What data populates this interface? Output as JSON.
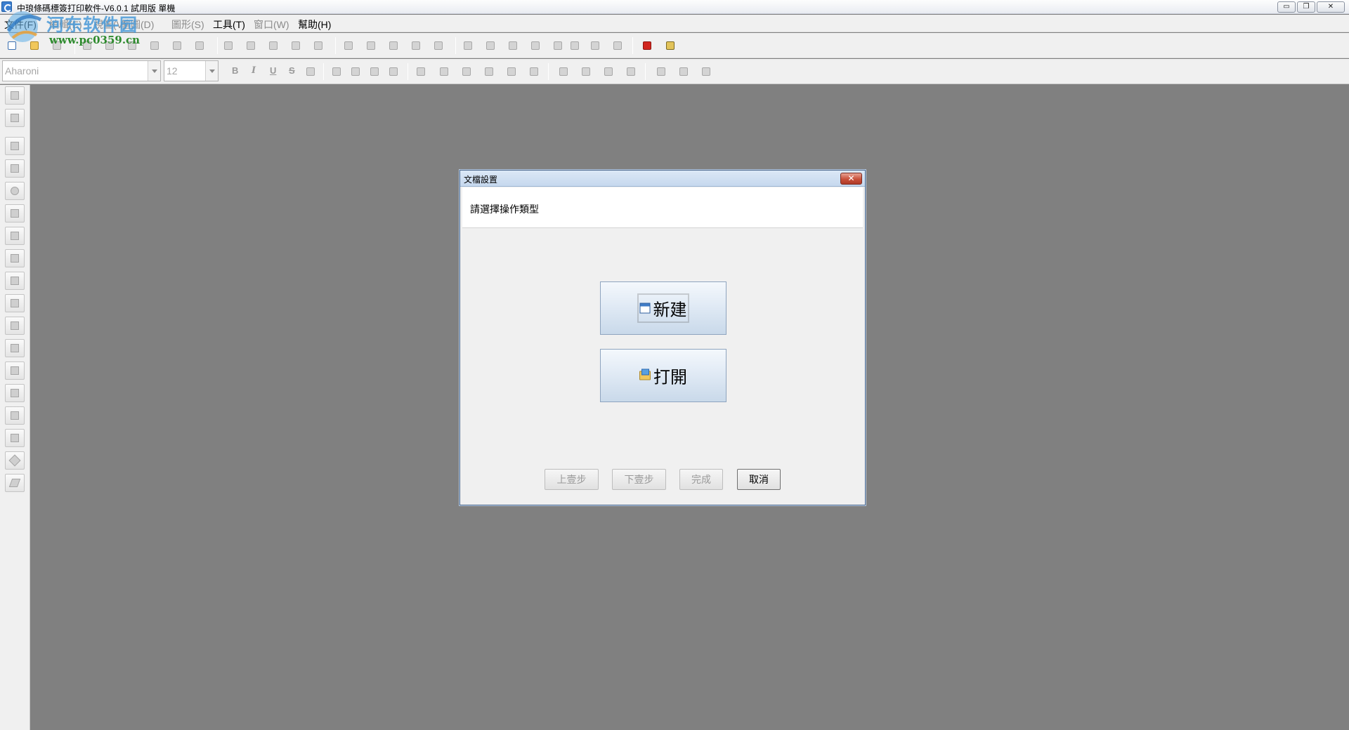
{
  "window": {
    "title": "中琅條碼標簽打印軟件-V6.0.1 試用版 單機",
    "minimize_glyph": "▭",
    "restore_glyph": "❐",
    "close_glyph": "✕"
  },
  "watermark": {
    "main": "河东软件园",
    "url": "www.pc0359.cn"
  },
  "menu": [
    {
      "label": "文件(F)",
      "enabled": true
    },
    {
      "label": "編輯(E)",
      "enabled": false
    },
    {
      "label": "視圖(V)",
      "enabled": false
    },
    {
      "label": "繪圖(D)",
      "enabled": false
    },
    {
      "label": "圖形(S)",
      "enabled": false
    },
    {
      "label": "工具(T)",
      "enabled": true
    },
    {
      "label": "窗口(W)",
      "enabled": false
    },
    {
      "label": "幫助(H)",
      "enabled": true
    }
  ],
  "format_bar": {
    "font_name": "Aharoni",
    "font_size": "12",
    "bold": "B",
    "italic": "I",
    "underline": "U",
    "strike": "S"
  },
  "dialog": {
    "title": "文檔設置",
    "close_glyph": "✕",
    "instruction": "請選擇操作類型",
    "new_label": "新建",
    "open_label": "打開",
    "prev_label": "上壹步",
    "next_label": "下壹步",
    "finish_label": "完成",
    "cancel_label": "取消"
  },
  "icons": {
    "toolbar1": [
      "new-doc-icon",
      "open-doc-icon",
      "save-icon",
      "print-preview-icon",
      "print-icon",
      "print-settings-icon",
      "database-icon",
      "data-source-icon",
      "grid-icon",
      "cut-icon",
      "copy-icon",
      "paste-icon",
      "undo-icon",
      "redo-icon",
      "zoom-in-icon",
      "zoom-out-icon",
      "zoom-fit-icon",
      "actual-size-icon",
      "page-fit-icon",
      "bring-front-icon",
      "send-back-icon",
      "group-icon",
      "ungroup-icon",
      "lock-icon",
      "delete-icon",
      "align-left-icon",
      "distribute-icon",
      "pdf-icon",
      "calculator-icon"
    ],
    "left_tools": [
      "pointer-icon",
      "pan-icon",
      "line-icon",
      "rectangle-icon",
      "ellipse-icon",
      "barcode-icon",
      "qrcode-icon",
      "text-icon",
      "paragraph-icon",
      "image-icon",
      "shape-icon",
      "table-icon",
      "curve-icon",
      "arc-icon",
      "polygon-icon",
      "triangle-icon",
      "diamond-icon",
      "parallelogram-icon"
    ]
  }
}
